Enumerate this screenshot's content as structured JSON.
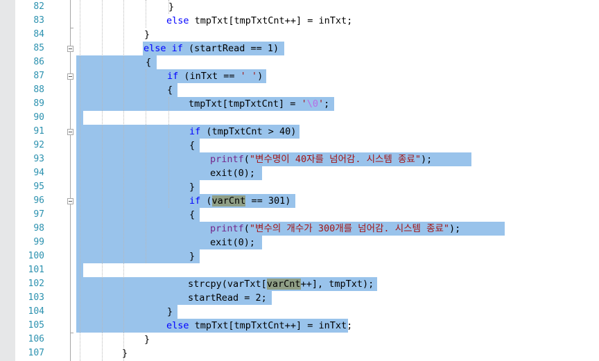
{
  "editor": {
    "colors": {
      "selection": "#99c3eb",
      "keyword": "#0000ff",
      "string": "#a31515",
      "function": "#74278b",
      "line_number": "#2b91af",
      "reference_highlight": "#8f9f86"
    },
    "line_numbers": [
      "82",
      "83",
      "84",
      "85",
      "86",
      "87",
      "88",
      "89",
      "90",
      "91",
      "92",
      "93",
      "94",
      "95",
      "96",
      "97",
      "98",
      "99",
      "100",
      "101",
      "102",
      "103",
      "104",
      "105",
      "106",
      "107"
    ],
    "fold_icons": [
      "collapse-icon-85",
      "collapse-icon-87",
      "collapse-icon-91",
      "collapse-icon-96"
    ],
    "lines": [
      {
        "parts": [
          {
            "t": "}"
          }
        ]
      },
      {
        "parts": [
          {
            "t": "else",
            "c": "kw"
          },
          {
            "t": " tmpTxt[tmpTxtCnt++] = inTxt;"
          }
        ]
      },
      {
        "parts": [
          {
            "t": "}"
          }
        ]
      },
      {
        "parts": [
          {
            "t": "else",
            "c": "kw"
          },
          {
            "t": " "
          },
          {
            "t": "if",
            "c": "kw"
          },
          {
            "t": " (startRead == 1)"
          }
        ]
      },
      {
        "parts": [
          {
            "t": "{"
          }
        ]
      },
      {
        "parts": [
          {
            "t": "if",
            "c": "kw"
          },
          {
            "t": " (inTxt == "
          },
          {
            "t": "' '",
            "c": "str"
          },
          {
            "t": ")"
          }
        ]
      },
      {
        "parts": [
          {
            "t": "{"
          }
        ]
      },
      {
        "parts": [
          {
            "t": "tmpTxt[tmpTxtCnt] = "
          },
          {
            "t": "'",
            "c": "str"
          },
          {
            "t": "\\0",
            "c": "esc"
          },
          {
            "t": "'",
            "c": "str"
          },
          {
            "t": ";"
          }
        ]
      },
      {
        "parts": []
      },
      {
        "parts": [
          {
            "t": "if",
            "c": "kw"
          },
          {
            "t": " (tmpTxtCnt > 40)"
          }
        ]
      },
      {
        "parts": [
          {
            "t": "{"
          }
        ]
      },
      {
        "parts": [
          {
            "t": "printf",
            "c": "fn"
          },
          {
            "t": "("
          },
          {
            "t": "\"변수명이 40자를 넘어감. 시스템 종료\"",
            "c": "str"
          },
          {
            "t": ");"
          }
        ]
      },
      {
        "parts": [
          {
            "t": "exit(0);"
          }
        ]
      },
      {
        "parts": [
          {
            "t": "}"
          }
        ]
      },
      {
        "parts": [
          {
            "t": "if",
            "c": "kw"
          },
          {
            "t": " ("
          },
          {
            "t": "varCnt",
            "c": "hl"
          },
          {
            "t": " == 301)"
          }
        ]
      },
      {
        "parts": [
          {
            "t": "{"
          }
        ]
      },
      {
        "parts": [
          {
            "t": "printf",
            "c": "fn"
          },
          {
            "t": "("
          },
          {
            "t": "\"변수의 개수가 300개를 넘어감. 시스템 종료\"",
            "c": "str"
          },
          {
            "t": ");"
          }
        ]
      },
      {
        "parts": [
          {
            "t": "exit(0);"
          }
        ]
      },
      {
        "parts": [
          {
            "t": "}"
          }
        ]
      },
      {
        "parts": []
      },
      {
        "parts": [
          {
            "t": "strcpy(varTxt["
          },
          {
            "t": "varCnt",
            "c": "hl"
          },
          {
            "t": "++], tmpTxt);"
          }
        ]
      },
      {
        "parts": [
          {
            "t": "startRead = 2;"
          }
        ]
      },
      {
        "parts": [
          {
            "t": "}"
          }
        ]
      },
      {
        "parts": [
          {
            "t": "else",
            "c": "kw"
          },
          {
            "t": " tmpTxt[tmpTxtCnt++] = inTxt;"
          }
        ]
      },
      {
        "parts": [
          {
            "t": "}"
          }
        ]
      },
      {
        "parts": [
          {
            "t": "}"
          }
        ]
      }
    ]
  }
}
